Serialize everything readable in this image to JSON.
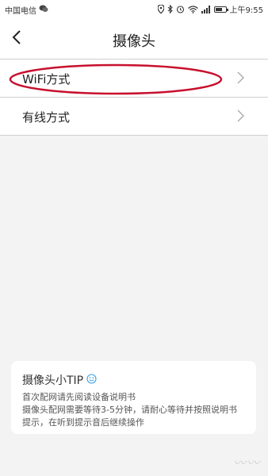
{
  "status_bar": {
    "carrier": "中国电信",
    "time": "上午9:55",
    "battery_level": 0.7
  },
  "header": {
    "title": "摄像头",
    "back_icon": "chevron-left-icon"
  },
  "menu": {
    "items": [
      {
        "label": "WiFi方式",
        "icon": "chevron-right-icon",
        "highlighted": true
      },
      {
        "label": "有线方式",
        "icon": "chevron-right-icon",
        "highlighted": false
      }
    ]
  },
  "tip": {
    "title": "摄像头小TIP",
    "icon": "smiley-icon",
    "line1": "首次配网请先阅读设备说明书",
    "line2": "摄像头配网需要等待3-5分钟，请耐心等待并按照说明书提示，在听到提示音后继续操作"
  },
  "colors": {
    "highlight_ellipse": "#c8102e",
    "background": "#f3f3f3",
    "smiley": "#3aa0e8"
  }
}
